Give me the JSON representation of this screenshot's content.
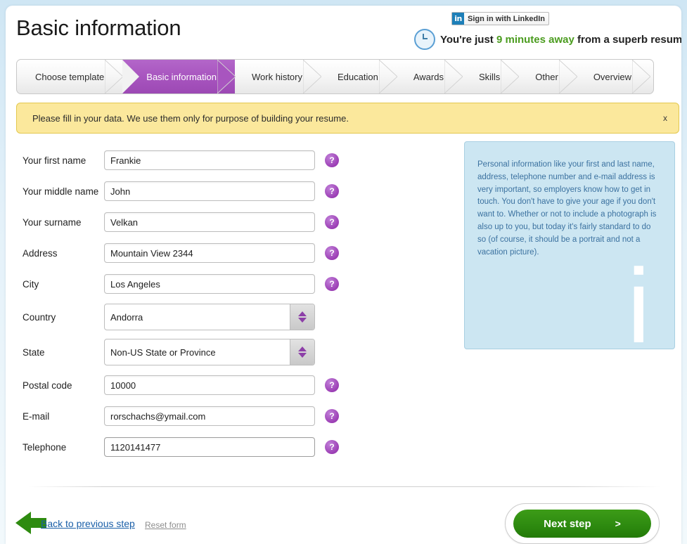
{
  "header": {
    "title": "Basic information",
    "linkedin_button": "Sign in with LinkedIn",
    "linkedin_glyph": "in",
    "timer_prefix": "You're just ",
    "timer_highlight": "9 minutes away",
    "timer_suffix": " from a superb resume"
  },
  "steps": [
    {
      "label": "Choose template",
      "active": false
    },
    {
      "label": "Basic information",
      "active": true
    },
    {
      "label": "Work history",
      "active": false
    },
    {
      "label": "Education",
      "active": false
    },
    {
      "label": "Awards",
      "active": false
    },
    {
      "label": "Skills",
      "active": false
    },
    {
      "label": "Other",
      "active": false
    },
    {
      "label": "Overview",
      "active": false
    }
  ],
  "notice": {
    "text": "Please fill in your data. We use them only for purpose of building your resume.",
    "close_label": "x"
  },
  "form": {
    "fields": [
      {
        "label": "Your first name",
        "value": "Frankie",
        "type": "text"
      },
      {
        "label": "Your middle name",
        "value": "John",
        "type": "text"
      },
      {
        "label": "Your surname",
        "value": "Velkan",
        "type": "text"
      },
      {
        "label": "Address",
        "value": "Mountain View 2344",
        "type": "text"
      },
      {
        "label": "City",
        "value": "Los Angeles",
        "type": "text"
      },
      {
        "label": "Country",
        "value": "Andorra",
        "type": "select"
      },
      {
        "label": "State",
        "value": "Non-US State or Province",
        "type": "select"
      },
      {
        "label": "Postal code",
        "value": "10000",
        "type": "text"
      },
      {
        "label": "E-mail",
        "value": "rorschachs@ymail.com",
        "type": "text"
      },
      {
        "label": "Telephone",
        "value": "1120141477",
        "type": "text"
      }
    ],
    "help_badge_label": "?"
  },
  "info_panel": {
    "text": "Personal information like your first and last name, address, telephone number and e-mail address is very important, so employers know how to get in touch. You don't have to give your age if you don't want to. Whether or not to include a photograph is also up to you, but today it's fairly standard to do so (of course, it should be a portrait and not a vacation picture).",
    "watermark": "i"
  },
  "footer": {
    "back_label": "Back to previous step",
    "reset_label": "Reset form",
    "next_label": "Next step",
    "next_chevron": ">"
  },
  "colors": {
    "accent_purple": "#a855bf",
    "notice_yellow": "#fbe89c",
    "info_blue": "#cce6f2",
    "next_green": "#2e8b10",
    "link_blue": "#1a5fa8",
    "timer_green": "#4b9c1f",
    "linkedin_blue": "#1d7fb8"
  }
}
